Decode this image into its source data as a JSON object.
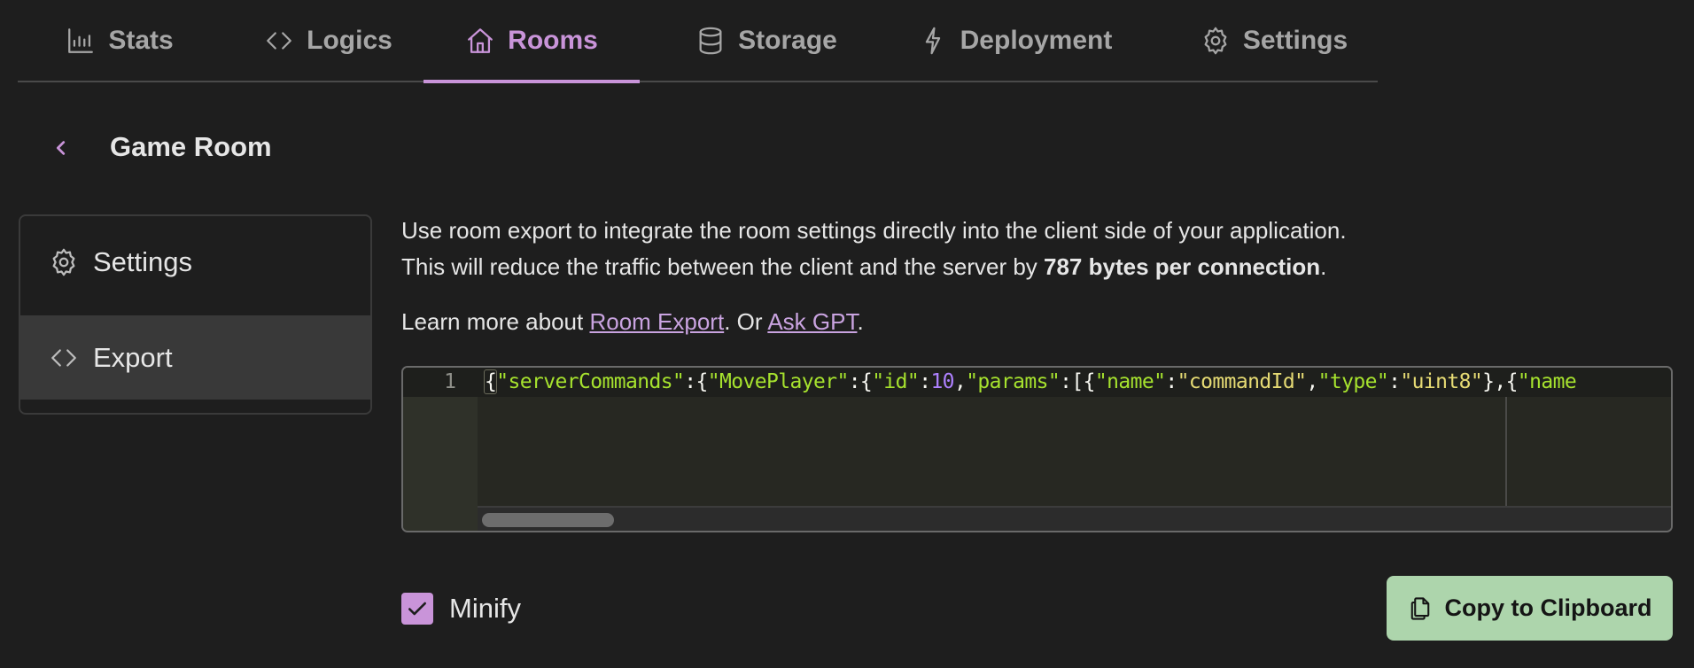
{
  "nav": {
    "tabs": [
      {
        "label": "Stats",
        "icon": "bar-chart-icon",
        "active": false
      },
      {
        "label": "Logics",
        "icon": "code-icon",
        "active": false
      },
      {
        "label": "Rooms",
        "icon": "home-icon",
        "active": true
      },
      {
        "label": "Storage",
        "icon": "database-icon",
        "active": false
      },
      {
        "label": "Deployment",
        "icon": "lightning-icon",
        "active": false
      },
      {
        "label": "Settings",
        "icon": "gear-icon",
        "active": false
      }
    ]
  },
  "header": {
    "back_icon": "chevron-left-icon",
    "title": "Game Room"
  },
  "sidebar": {
    "items": [
      {
        "label": "Settings",
        "icon": "gear-icon",
        "active": false
      },
      {
        "label": "Export",
        "icon": "code-icon",
        "active": true
      }
    ]
  },
  "content": {
    "description_line1": "Use room export to integrate the room settings directly into the client side of your application.",
    "description_line2_prefix": "This will reduce the traffic between the client and the server by ",
    "description_line2_bold": "787 bytes per connection",
    "description_line2_suffix": ".",
    "learn_prefix": "Learn more about ",
    "learn_link1": "Room Export",
    "learn_middle": ". Or ",
    "learn_link2": "Ask GPT",
    "learn_suffix": "."
  },
  "editor": {
    "line_number": "1",
    "code_tokens": [
      {
        "t": "p",
        "v": "{"
      },
      {
        "t": "key",
        "v": "\"serverCommands\""
      },
      {
        "t": "p",
        "v": ":{"
      },
      {
        "t": "key",
        "v": "\"MovePlayer\""
      },
      {
        "t": "p",
        "v": ":{"
      },
      {
        "t": "key",
        "v": "\"id\""
      },
      {
        "t": "p",
        "v": ":"
      },
      {
        "t": "num",
        "v": "10"
      },
      {
        "t": "p",
        "v": ","
      },
      {
        "t": "key",
        "v": "\"params\""
      },
      {
        "t": "p",
        "v": ":[{"
      },
      {
        "t": "key",
        "v": "\"name\""
      },
      {
        "t": "p",
        "v": ":"
      },
      {
        "t": "str",
        "v": "\"commandId\""
      },
      {
        "t": "p",
        "v": ","
      },
      {
        "t": "key",
        "v": "\"type\""
      },
      {
        "t": "p",
        "v": ":"
      },
      {
        "t": "str",
        "v": "\"uint8\""
      },
      {
        "t": "p",
        "v": "},{"
      },
      {
        "t": "key",
        "v": "\"name"
      }
    ],
    "colors": {
      "key": "#a6e22e",
      "string": "#e6db74",
      "number": "#ae81ff",
      "punct": "#f8f8f2"
    }
  },
  "options": {
    "minify_label": "Minify",
    "minify_checked": true
  },
  "actions": {
    "copy_label": "Copy to Clipboard",
    "copy_icon": "copy-icon"
  },
  "colors": {
    "accent": "#c994d9",
    "copy_button_bg": "#add5ac",
    "background": "#1e1e1e"
  }
}
